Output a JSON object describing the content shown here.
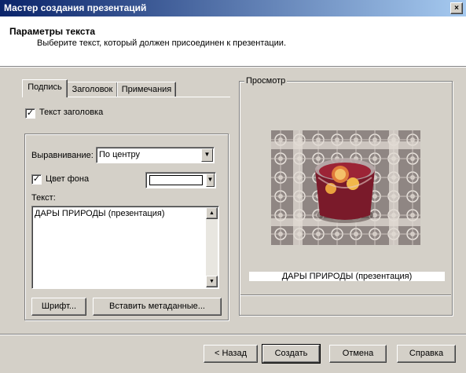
{
  "window": {
    "title": "Мастер создания презентаций",
    "close_glyph": "×"
  },
  "header": {
    "title": "Параметры текста",
    "subtitle": "Выберите текст, который должен присоединен к презентации."
  },
  "tabs": [
    {
      "label": "Подпись",
      "active": true
    },
    {
      "label": "Заголовок",
      "active": false
    },
    {
      "label": "Примечания",
      "active": false
    }
  ],
  "caption": {
    "title_checkbox_label": "Текст заголовка",
    "title_checked": true,
    "alignment_label": "Выравнивание:",
    "alignment_value": "По центру",
    "bgcolor_label": "Цвет фона",
    "bgcolor_checked": true,
    "bgcolor_value": "#ffffff",
    "text_label": "Текст:",
    "text_value": "ДАРЫ ПРИРОДЫ (презентация)",
    "font_button": "Шрифт...",
    "insert_meta_button": "Вставить метаданные..."
  },
  "preview": {
    "label": "Просмотр",
    "caption": "ДАРЫ ПРИРОДЫ (презентация)"
  },
  "footer": {
    "back_button": "< Назад",
    "create_button": "Создать",
    "cancel_button": "Отмена",
    "help_button": "Справка"
  },
  "colors": {
    "titlebar_start": "#0a246a",
    "titlebar_end": "#a6caf0",
    "face": "#d4d0c8"
  }
}
